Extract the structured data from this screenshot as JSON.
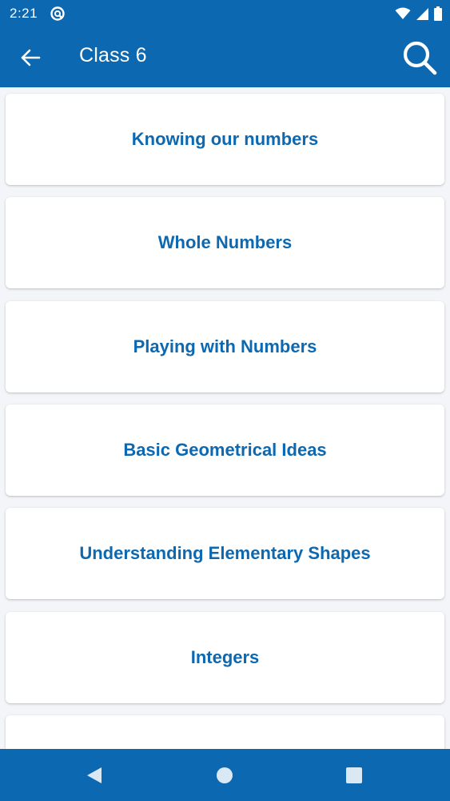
{
  "status_bar": {
    "time": "2:21",
    "icons": [
      "app-notification-icon",
      "wifi-icon",
      "signal-icon",
      "battery-icon"
    ]
  },
  "app_bar": {
    "title": "Class 6",
    "back_icon": "arrow-left-icon",
    "search_icon": "search-icon",
    "color": "#0c68b0"
  },
  "chapters": [
    {
      "label": "Knowing our numbers"
    },
    {
      "label": "Whole Numbers"
    },
    {
      "label": "Playing with Numbers"
    },
    {
      "label": "Basic Geometrical Ideas"
    },
    {
      "label": "Understanding Elementary Shapes"
    },
    {
      "label": "Integers"
    },
    {
      "label": ""
    }
  ],
  "nav_bar": {
    "buttons": [
      "nav-back-icon",
      "nav-home-icon",
      "nav-recents-icon"
    ]
  },
  "colors": {
    "primary": "#0c68b0",
    "background": "#f3f5f8",
    "card": "#ffffff"
  }
}
